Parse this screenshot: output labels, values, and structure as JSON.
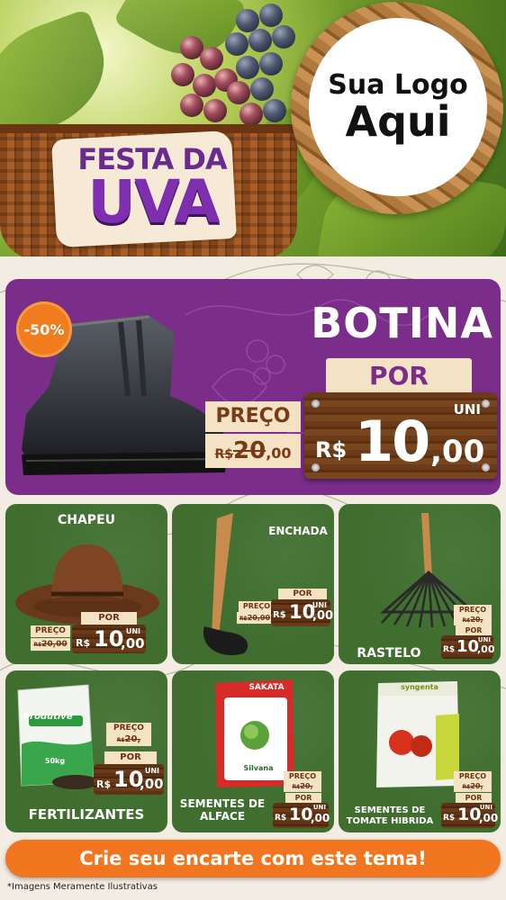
{
  "header": {
    "title_line1": "FESTA DA",
    "title_line2": "UVA",
    "logo_line1": "Sua Logo",
    "logo_line2": "Aqui"
  },
  "featured": {
    "name": "BOTINA",
    "discount_badge": "-50%",
    "preco_label": "PREÇO",
    "old_currency": "R$",
    "old_int": "20",
    "old_dec": ",00",
    "por_label": "POR",
    "unit": "UNI",
    "currency": "R$",
    "price_int": "10",
    "price_dec": ",00"
  },
  "products": [
    {
      "name": "CHAPEU",
      "preco_label": "PREÇO",
      "old_price": "20,00",
      "old_currency": "R$",
      "por_label": "POR",
      "unit": "UNI",
      "currency": "R$",
      "price_int": "10",
      "price_dec": ",00"
    },
    {
      "name": "ENCHADA",
      "preco_label": "PREÇO",
      "old_price": "20,00",
      "old_currency": "R$",
      "por_label": "POR",
      "unit": "UNI",
      "currency": "R$",
      "price_int": "10",
      "price_dec": ",00"
    },
    {
      "name": "RASTELO",
      "preco_label": "PREÇO",
      "old_price": "20,",
      "old_currency": "R$",
      "por_label": "POR",
      "unit": "UNI",
      "currency": "R$",
      "price_int": "10",
      "price_dec": ",00"
    },
    {
      "name": "FERTILIZANTES",
      "preco_label": "PREÇO",
      "old_price": "20,",
      "old_currency": "R$",
      "por_label": "POR",
      "unit": "UNI",
      "currency": "R$",
      "price_int": "10",
      "price_dec": ",00",
      "package_brand": "Produtive",
      "package_weight": "50kg"
    },
    {
      "name_line1": "SEMENTES DE",
      "name_line2": "ALFACE",
      "preco_label": "PREÇO",
      "old_price": "20,",
      "old_currency": "R$",
      "por_label": "POR",
      "unit": "UNI",
      "currency": "R$",
      "price_int": "10",
      "price_dec": ",00",
      "package_brand": "SAKATA",
      "package_sub": "Silvana"
    },
    {
      "name_line1": "SEMENTES DE",
      "name_line2": "TOMATE HIBRIDA",
      "preco_label": "PREÇO",
      "old_price": "20,",
      "old_currency": "R$",
      "por_label": "POR",
      "unit": "UNI",
      "currency": "R$",
      "price_int": "10",
      "price_dec": ",00",
      "package_brand": "syngenta"
    }
  ],
  "cta": "Crie seu encarte com este tema!",
  "disclaimer": "*Imagens Meramente Ilustrativas",
  "colors": {
    "purple": "#7b2d8a",
    "green": "#3f6e2f",
    "orange": "#f27520",
    "cream": "#f4e2c5",
    "wood": "#5e3214"
  }
}
